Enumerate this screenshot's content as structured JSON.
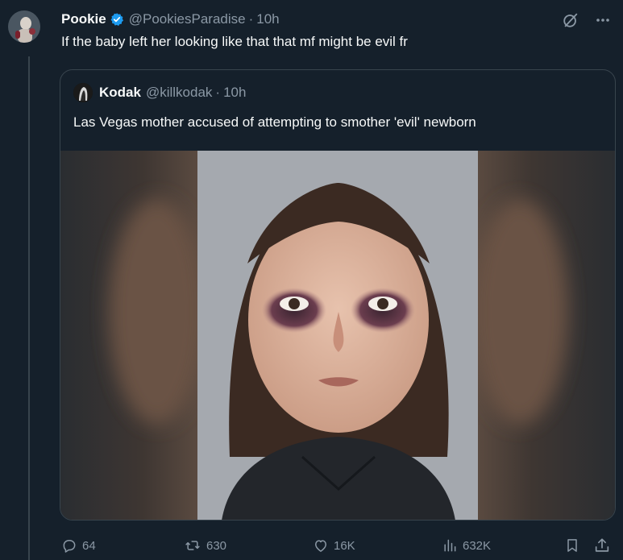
{
  "tweet": {
    "author": {
      "display_name": "Pookie",
      "handle": "@PookiesParadise",
      "verified": true
    },
    "separator": "·",
    "timestamp": "10h",
    "text": "If the baby left her looking like that that mf might be evil fr",
    "quote": {
      "author": {
        "display_name": "Kodak",
        "handle": "@killkodak"
      },
      "separator": "·",
      "timestamp": "10h",
      "text": "Las Vegas mother accused of attempting to smother 'evil' newborn",
      "media": {
        "icon": "photo-placeholder"
      }
    },
    "actions": {
      "replies": "64",
      "retweets": "630",
      "likes": "16K",
      "views": "632K"
    }
  },
  "icons": {
    "grok": "grok-icon",
    "more": "more-icon",
    "reply": "reply-icon",
    "retweet": "retweet-icon",
    "like": "heart-icon",
    "views": "views-icon",
    "bookmark": "bookmark-icon",
    "share": "share-icon",
    "verified": "verified-badge-icon"
  },
  "colors": {
    "background": "#15202b",
    "primary_text": "#f7f9f9",
    "secondary_text": "#8b98a5",
    "border": "#38444d",
    "verified_blue": "#1d9bf0"
  }
}
